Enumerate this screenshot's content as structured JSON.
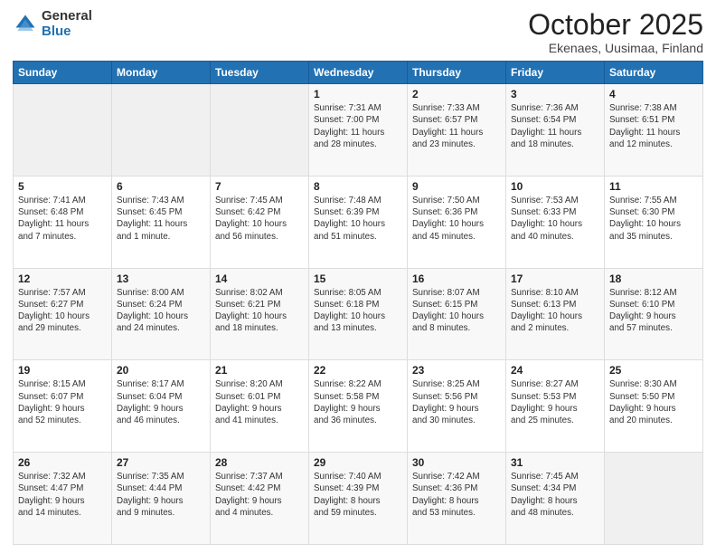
{
  "header": {
    "logo_general": "General",
    "logo_blue": "Blue",
    "month_title": "October 2025",
    "location": "Ekenaes, Uusimaa, Finland"
  },
  "days_of_week": [
    "Sunday",
    "Monday",
    "Tuesday",
    "Wednesday",
    "Thursday",
    "Friday",
    "Saturday"
  ],
  "weeks": [
    [
      {
        "day": "",
        "info": ""
      },
      {
        "day": "",
        "info": ""
      },
      {
        "day": "",
        "info": ""
      },
      {
        "day": "1",
        "info": "Sunrise: 7:31 AM\nSunset: 7:00 PM\nDaylight: 11 hours\nand 28 minutes."
      },
      {
        "day": "2",
        "info": "Sunrise: 7:33 AM\nSunset: 6:57 PM\nDaylight: 11 hours\nand 23 minutes."
      },
      {
        "day": "3",
        "info": "Sunrise: 7:36 AM\nSunset: 6:54 PM\nDaylight: 11 hours\nand 18 minutes."
      },
      {
        "day": "4",
        "info": "Sunrise: 7:38 AM\nSunset: 6:51 PM\nDaylight: 11 hours\nand 12 minutes."
      }
    ],
    [
      {
        "day": "5",
        "info": "Sunrise: 7:41 AM\nSunset: 6:48 PM\nDaylight: 11 hours\nand 7 minutes."
      },
      {
        "day": "6",
        "info": "Sunrise: 7:43 AM\nSunset: 6:45 PM\nDaylight: 11 hours\nand 1 minute."
      },
      {
        "day": "7",
        "info": "Sunrise: 7:45 AM\nSunset: 6:42 PM\nDaylight: 10 hours\nand 56 minutes."
      },
      {
        "day": "8",
        "info": "Sunrise: 7:48 AM\nSunset: 6:39 PM\nDaylight: 10 hours\nand 51 minutes."
      },
      {
        "day": "9",
        "info": "Sunrise: 7:50 AM\nSunset: 6:36 PM\nDaylight: 10 hours\nand 45 minutes."
      },
      {
        "day": "10",
        "info": "Sunrise: 7:53 AM\nSunset: 6:33 PM\nDaylight: 10 hours\nand 40 minutes."
      },
      {
        "day": "11",
        "info": "Sunrise: 7:55 AM\nSunset: 6:30 PM\nDaylight: 10 hours\nand 35 minutes."
      }
    ],
    [
      {
        "day": "12",
        "info": "Sunrise: 7:57 AM\nSunset: 6:27 PM\nDaylight: 10 hours\nand 29 minutes."
      },
      {
        "day": "13",
        "info": "Sunrise: 8:00 AM\nSunset: 6:24 PM\nDaylight: 10 hours\nand 24 minutes."
      },
      {
        "day": "14",
        "info": "Sunrise: 8:02 AM\nSunset: 6:21 PM\nDaylight: 10 hours\nand 18 minutes."
      },
      {
        "day": "15",
        "info": "Sunrise: 8:05 AM\nSunset: 6:18 PM\nDaylight: 10 hours\nand 13 minutes."
      },
      {
        "day": "16",
        "info": "Sunrise: 8:07 AM\nSunset: 6:15 PM\nDaylight: 10 hours\nand 8 minutes."
      },
      {
        "day": "17",
        "info": "Sunrise: 8:10 AM\nSunset: 6:13 PM\nDaylight: 10 hours\nand 2 minutes."
      },
      {
        "day": "18",
        "info": "Sunrise: 8:12 AM\nSunset: 6:10 PM\nDaylight: 9 hours\nand 57 minutes."
      }
    ],
    [
      {
        "day": "19",
        "info": "Sunrise: 8:15 AM\nSunset: 6:07 PM\nDaylight: 9 hours\nand 52 minutes."
      },
      {
        "day": "20",
        "info": "Sunrise: 8:17 AM\nSunset: 6:04 PM\nDaylight: 9 hours\nand 46 minutes."
      },
      {
        "day": "21",
        "info": "Sunrise: 8:20 AM\nSunset: 6:01 PM\nDaylight: 9 hours\nand 41 minutes."
      },
      {
        "day": "22",
        "info": "Sunrise: 8:22 AM\nSunset: 5:58 PM\nDaylight: 9 hours\nand 36 minutes."
      },
      {
        "day": "23",
        "info": "Sunrise: 8:25 AM\nSunset: 5:56 PM\nDaylight: 9 hours\nand 30 minutes."
      },
      {
        "day": "24",
        "info": "Sunrise: 8:27 AM\nSunset: 5:53 PM\nDaylight: 9 hours\nand 25 minutes."
      },
      {
        "day": "25",
        "info": "Sunrise: 8:30 AM\nSunset: 5:50 PM\nDaylight: 9 hours\nand 20 minutes."
      }
    ],
    [
      {
        "day": "26",
        "info": "Sunrise: 7:32 AM\nSunset: 4:47 PM\nDaylight: 9 hours\nand 14 minutes."
      },
      {
        "day": "27",
        "info": "Sunrise: 7:35 AM\nSunset: 4:44 PM\nDaylight: 9 hours\nand 9 minutes."
      },
      {
        "day": "28",
        "info": "Sunrise: 7:37 AM\nSunset: 4:42 PM\nDaylight: 9 hours\nand 4 minutes."
      },
      {
        "day": "29",
        "info": "Sunrise: 7:40 AM\nSunset: 4:39 PM\nDaylight: 8 hours\nand 59 minutes."
      },
      {
        "day": "30",
        "info": "Sunrise: 7:42 AM\nSunset: 4:36 PM\nDaylight: 8 hours\nand 53 minutes."
      },
      {
        "day": "31",
        "info": "Sunrise: 7:45 AM\nSunset: 4:34 PM\nDaylight: 8 hours\nand 48 minutes."
      },
      {
        "day": "",
        "info": ""
      }
    ]
  ]
}
